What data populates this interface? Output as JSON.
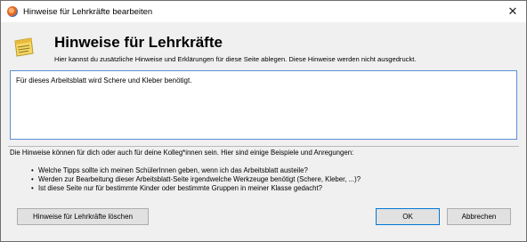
{
  "window": {
    "title": "Hinweise für Lehrkräfte bearbeiten",
    "close_glyph": "✕"
  },
  "header": {
    "title": "Hinweise für Lehrkräfte",
    "subtitle": "Hier kannst du zusätzliche Hinweise und Erklärungen für diese Seite ablegen. Diese Hinweise werden nicht ausgedruckt."
  },
  "notes": {
    "value": "Für dieses Arbeitsblatt wird Schere und Kleber benötigt."
  },
  "info": {
    "intro": "Die Hinweise können für dich oder auch für deine Kolleg*innen sein. Hier sind einige Beispiele und Anregungen:",
    "examples": [
      "Welche Tipps sollte ich meinen SchülerInnen geben, wenn ich das Arbeitsblatt austeile?",
      "Werden zur Bearbeitung dieser Arbeitsblatt-Seite irgendwelche Werkzeuge benötigt (Schere, Kleber, ...)?",
      "Ist diese Seite nur für bestimmte Kinder oder bestimmte Gruppen in meiner Klasse gedacht?"
    ]
  },
  "buttons": {
    "delete_label": "Hinweise für Lehrkräfte löschen",
    "ok_label": "OK",
    "cancel_label": "Abbrechen"
  },
  "icons": {
    "app": "app-logo-icon",
    "header": "notepad-icon",
    "close": "close-icon"
  },
  "colors": {
    "focus_border": "#5b8fd6",
    "default_button_border": "#0078d7"
  }
}
